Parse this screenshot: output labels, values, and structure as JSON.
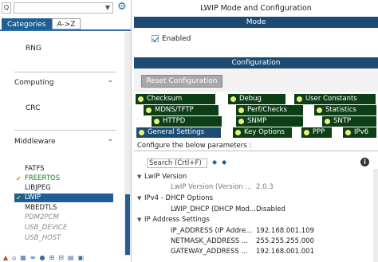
{
  "left": {
    "search_glyph": "Q",
    "tabs": [
      "Categories",
      "A->Z"
    ],
    "rng": "RNG",
    "computing": "Computing",
    "crc": "CRC",
    "middleware": "Middleware",
    "items": [
      {
        "label": "FATFS",
        "state": "normal"
      },
      {
        "label": "FREERTOS",
        "state": "ok"
      },
      {
        "label": "LIBJPEG",
        "state": "normal"
      },
      {
        "label": "LWIP",
        "state": "selected"
      },
      {
        "label": "MBEDTLS",
        "state": "normal"
      },
      {
        "label": "PDM2PCM",
        "state": "disabled"
      },
      {
        "label": "USB_DEVICE",
        "state": "disabled"
      },
      {
        "label": "USB_HOST",
        "state": "disabled"
      }
    ]
  },
  "right": {
    "title": "LWIP Mode and Configuration",
    "mode_header": "Mode",
    "enabled_label": "Enabled",
    "config_header": "Configuration",
    "reset_button": "Reset Configuration",
    "tabs_row1": [
      "Checksum",
      "Debug",
      "User Constants"
    ],
    "tabs_row2": [
      "MDNS/TFTP",
      "Perf/Checks",
      "Statistics"
    ],
    "tabs_row3": [
      "HTTPD",
      "SNMP",
      "SNTP"
    ],
    "tabs_row4": [
      "General Settings",
      "Key Options",
      "PPP",
      "IPv6"
    ],
    "configure_label": "Configure the below parameters :",
    "search_placeholder": "Search (Crtl+F)",
    "groups": {
      "lwip_version": {
        "title": "LwIP Version",
        "param": "LwIP Version (Version ...",
        "value": "2.0.3"
      },
      "dhcp": {
        "title": "IPv4 - DHCP Options",
        "param": "LWIP_DHCP (DHCP Mod...",
        "value": "Disabled"
      },
      "ip": {
        "title": "IP Address Settings",
        "rows": [
          {
            "param": "IP_ADDRESS (IP Addre...",
            "value": "192.168.001.109"
          },
          {
            "param": "NETMASK_ADDRESS ...",
            "value": "255.255.255.000"
          },
          {
            "param": "GATEWAY_ADDRESS ...",
            "value": "192.168.001.001"
          }
        ]
      }
    }
  },
  "colors": {
    "selection_blue": "#1f5f96",
    "header_navy": "#1c4c73",
    "tab_dark_green": "#0d3f17",
    "tab_dot_yellow": "#e9f27a",
    "ok_green": "#1b7d1b"
  }
}
